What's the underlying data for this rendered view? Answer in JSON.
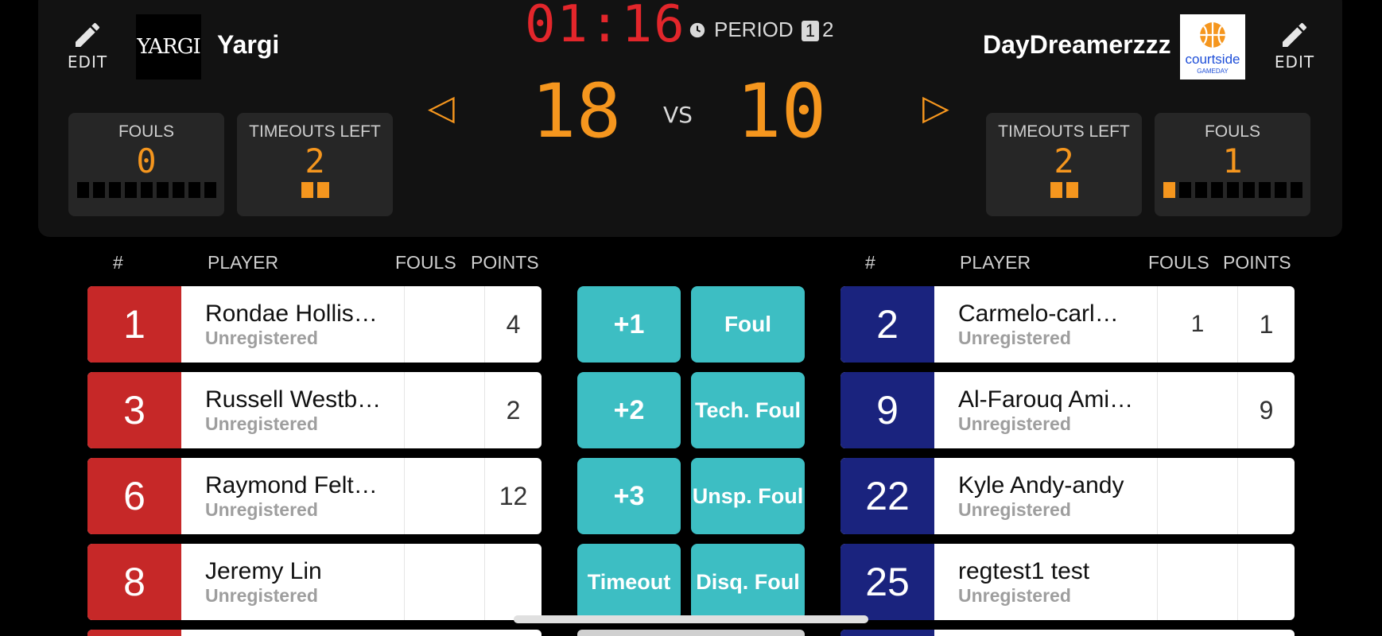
{
  "scoreboard": {
    "clock": "01:16",
    "period_label": "PERIOD",
    "periods": [
      "1",
      "2"
    ],
    "active_period": "1",
    "vs_label": "VS",
    "left_arrow": "◁",
    "right_arrow": "▷",
    "colors": {
      "accent": "#f5961e",
      "clock": "#e3262b",
      "action": "#3dbec3"
    }
  },
  "home": {
    "name": "Yargi",
    "logo_text": "YARGI",
    "edit_label": "EDIT",
    "score": "18",
    "fouls_label": "FOULS",
    "fouls": "0",
    "fouls_fill": 0,
    "timeouts_label": "TIMEOUTS LEFT",
    "timeouts": "2",
    "color": "#c62828"
  },
  "away": {
    "name": "DayDreamerzzz",
    "logo_text": "courtside",
    "logo_subtext": "GAMEDAY",
    "edit_label": "EDIT",
    "score": "10",
    "fouls_label": "FOULS",
    "fouls": "1",
    "fouls_fill": 1,
    "timeouts_label": "TIMEOUTS LEFT",
    "timeouts": "2",
    "color": "#1a237e"
  },
  "table_headers": {
    "num": "#",
    "player": "PLAYER",
    "fouls": "FOULS",
    "points": "POINTS"
  },
  "home_players": [
    {
      "number": "1",
      "name": "Rondae  Hollis…",
      "status": "Unregistered",
      "fouls": "",
      "points": "4"
    },
    {
      "number": "3",
      "name": "Russell Westb…",
      "status": "Unregistered",
      "fouls": "",
      "points": "2"
    },
    {
      "number": "6",
      "name": "Raymond Felt…",
      "status": "Unregistered",
      "fouls": "",
      "points": "12"
    },
    {
      "number": "8",
      "name": "Jeremy Lin",
      "status": "Unregistered",
      "fouls": "",
      "points": ""
    }
  ],
  "away_players": [
    {
      "number": "2",
      "name": "Carmelo-carl…",
      "status": "Unregistered",
      "fouls": "1",
      "points": "1"
    },
    {
      "number": "9",
      "name": "Al-Farouq Ami…",
      "status": "Unregistered",
      "fouls": "",
      "points": "9"
    },
    {
      "number": "22",
      "name": "Kyle  Andy-andy",
      "status": "Unregistered",
      "fouls": "",
      "points": ""
    },
    {
      "number": "25",
      "name": "regtest1 test",
      "status": "Unregistered",
      "fouls": "",
      "points": ""
    }
  ],
  "actions": {
    "plus1": "+1",
    "plus2": "+2",
    "plus3": "+3",
    "timeout": "Timeout",
    "foul": "Foul",
    "tech_foul": "Tech. Foul",
    "unsp_foul": "Unsp. Foul",
    "disq_foul": "Disq. Foul"
  }
}
